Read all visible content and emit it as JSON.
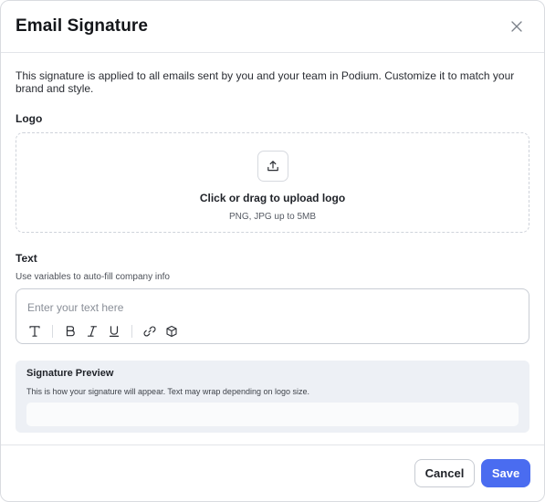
{
  "modal": {
    "title": "Email Signature",
    "description": "This signature is applied to all emails sent by you and your team in Podium. Customize it to match your brand and style."
  },
  "logo": {
    "label": "Logo",
    "upload_title": "Click or drag to upload logo",
    "upload_hint": "PNG, JPG up to 5MB"
  },
  "text": {
    "label": "Text",
    "hint": "Use variables to auto-fill company info",
    "placeholder": "Enter your text here",
    "value": ""
  },
  "toolbar": {
    "icons": [
      "text-style-icon",
      "bold-icon",
      "italic-icon",
      "underline-icon",
      "link-icon",
      "variable-cube-icon"
    ]
  },
  "preview": {
    "title": "Signature Preview",
    "description": "This is how your signature will appear. Text may wrap depending on logo size."
  },
  "footer": {
    "cancel_label": "Cancel",
    "save_label": "Save"
  },
  "colors": {
    "primary": "#4a6cf0",
    "preview_bg": "#edf0f5"
  }
}
